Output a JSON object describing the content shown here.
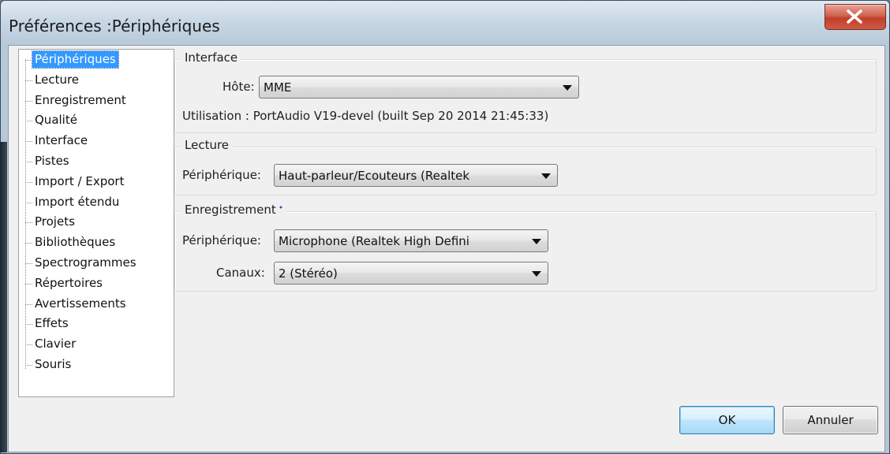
{
  "window": {
    "title": "Préférences :Périphériques"
  },
  "tree": {
    "items": [
      {
        "label": "Périphériques",
        "selected": true
      },
      {
        "label": "Lecture"
      },
      {
        "label": "Enregistrement"
      },
      {
        "label": "Qualité"
      },
      {
        "label": "Interface"
      },
      {
        "label": "Pistes"
      },
      {
        "label": "Import / Export"
      },
      {
        "label": "Import étendu"
      },
      {
        "label": "Projets"
      },
      {
        "label": "Bibliothèques"
      },
      {
        "label": "Spectrogrammes"
      },
      {
        "label": "Répertoires"
      },
      {
        "label": "Avertissements"
      },
      {
        "label": "Effets"
      },
      {
        "label": "Clavier"
      },
      {
        "label": "Souris"
      }
    ]
  },
  "interface_group": {
    "title": "Interface",
    "host_label": "Hôte:",
    "host_value": "MME",
    "usage_text": "Utilisation : PortAudio V19-devel (built Sep 20 2014 21:45:33)"
  },
  "playback_group": {
    "title": "Lecture",
    "device_label": "Périphérique:",
    "device_value": "Haut-parleur/Ecouteurs (Realtek"
  },
  "recording_group": {
    "title": "Enregistrement",
    "title_marker": "•",
    "device_label": "Périphérique:",
    "device_value": "Microphone (Realtek High Defini",
    "channels_label": "Canaux:",
    "channels_value": "2 (Stéréo)"
  },
  "buttons": {
    "ok": "OK",
    "cancel": "Annuler"
  },
  "colors": {
    "selection": "#3399ff",
    "close_button": "#c2402a"
  }
}
